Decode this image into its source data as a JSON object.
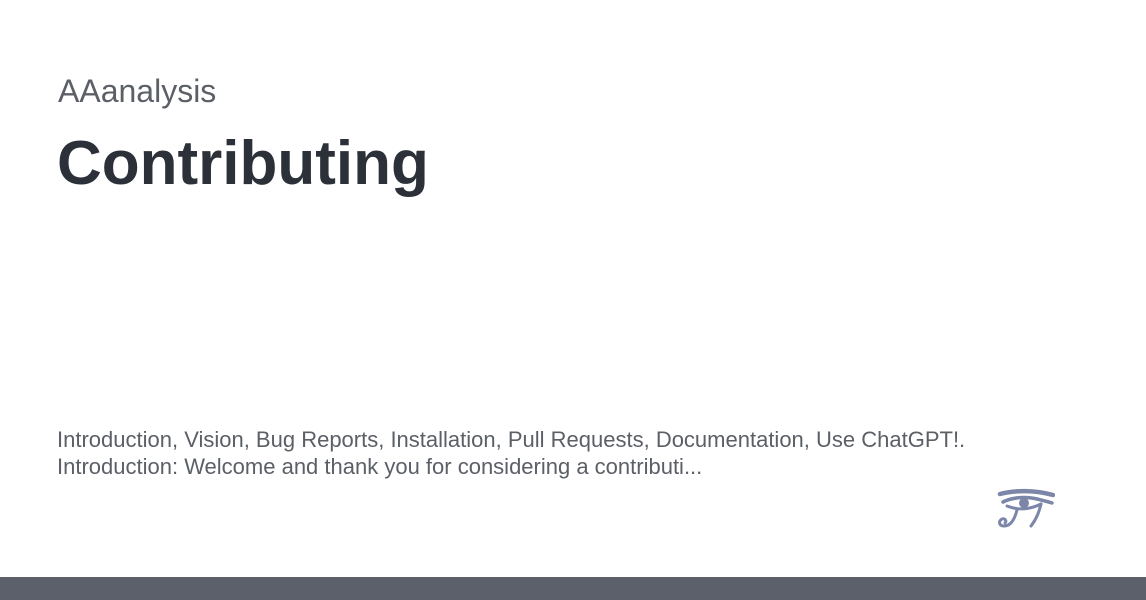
{
  "header": {
    "project_name": "AAanalysis",
    "title": "Contributing"
  },
  "description": {
    "line1": "Introduction, Vision, Bug Reports, Installation, Pull Requests, Documentation, Use ChatGPT!.",
    "line2": "Introduction: Welcome and thank you for considering a contributi..."
  },
  "logo": {
    "icon": "eye-of-horus-icon",
    "color": "#7b86a8"
  },
  "footer": {
    "color": "#5b606b"
  }
}
